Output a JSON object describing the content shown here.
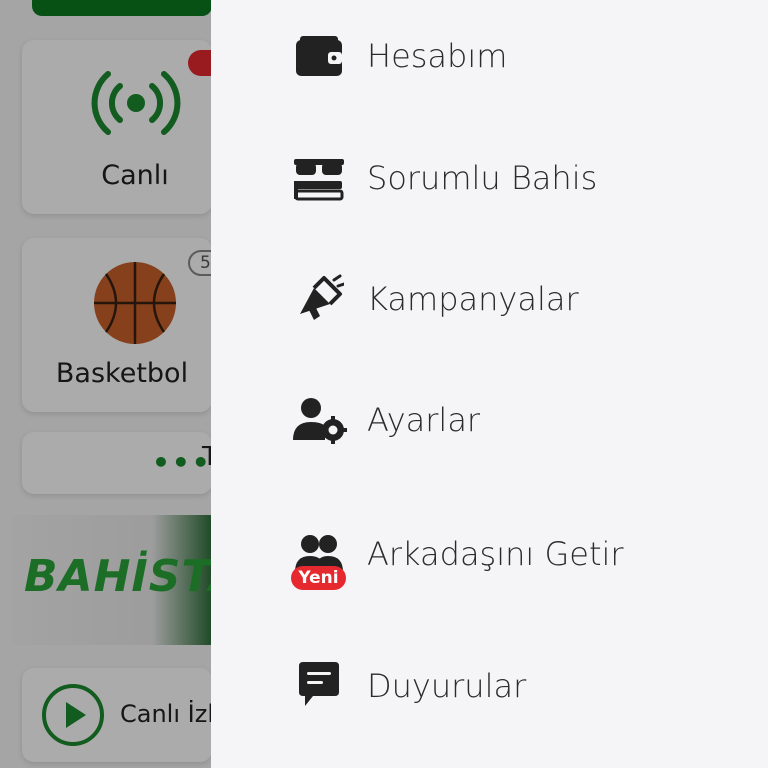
{
  "background": {
    "tiles": {
      "live_label": "Canlı",
      "basketball_label": "Basketbol",
      "basketball_count": "5",
      "more_text": "T",
      "banner_text": "BAHİSTA",
      "stream_label": "Canlı İzl"
    }
  },
  "drawer": {
    "items": [
      {
        "label": "Hesabım",
        "icon": "wallet-icon"
      },
      {
        "label": "Sorumlu Bahis",
        "icon": "responsible-gaming-icon"
      },
      {
        "label": "Kampanyalar",
        "icon": "megaphone-icon"
      },
      {
        "label": "Ayarlar",
        "icon": "user-settings-icon"
      },
      {
        "label": "Arkadaşını Getir",
        "icon": "invite-friends-icon",
        "badge": "Yeni"
      },
      {
        "label": "Duyurular",
        "icon": "announcement-icon"
      }
    ]
  },
  "colors": {
    "accent_green": "#0b7a1e",
    "badge_red": "#e5292f",
    "drawer_bg": "#f5f5f7"
  }
}
